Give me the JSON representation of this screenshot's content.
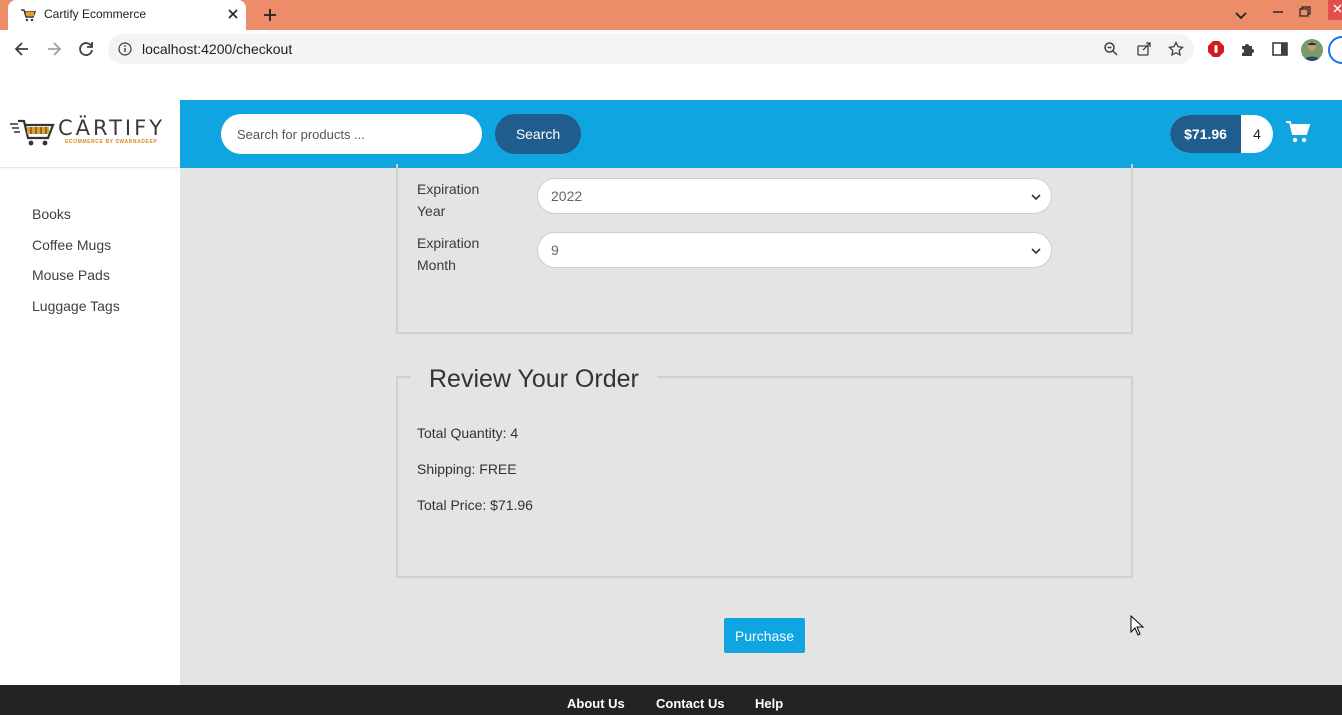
{
  "browser": {
    "tab_title": "Cartify Ecommerce",
    "url": "localhost:4200/checkout"
  },
  "logo": {
    "name": "CÄRTIFY",
    "tagline": "ECOMMERCE BY SWARNADEEP"
  },
  "sidebar": {
    "items": [
      {
        "label": "Books"
      },
      {
        "label": "Coffee Mugs"
      },
      {
        "label": "Mouse Pads"
      },
      {
        "label": "Luggage Tags"
      }
    ]
  },
  "header": {
    "search_placeholder": "Search for products ...",
    "search_button": "Search",
    "cart_total": "$71.96",
    "cart_quantity": "4"
  },
  "credit_card": {
    "expiration_year_label": "Expiration Year",
    "expiration_year_value": "2022",
    "expiration_month_label": "Expiration Month",
    "expiration_month_value": "9"
  },
  "review": {
    "legend": "Review Your Order",
    "total_quantity": "Total Quantity: 4",
    "shipping": "Shipping: FREE",
    "total_price": "Total Price: $71.96"
  },
  "purchase_button": "Purchase",
  "footer": {
    "links": [
      {
        "label": "About Us"
      },
      {
        "label": "Contact Us"
      },
      {
        "label": "Help"
      }
    ]
  },
  "colors": {
    "tab_strip": "#ec8c69",
    "header": "#0fa5e0",
    "accent_dark": "#205c8c",
    "content_bg": "#e4e4e4",
    "footer": "#232323"
  },
  "icons": [
    "cart-favicon-icon",
    "close-icon",
    "plus-icon",
    "chevron-down-icon",
    "minimize-icon",
    "restore-icon",
    "back-icon",
    "forward-icon",
    "reload-icon",
    "info-icon",
    "zoom-icon",
    "share-icon",
    "star-icon",
    "adblock-icon",
    "puzzle-icon",
    "side-panel-icon",
    "shopping-cart-icon",
    "mouse-cursor-icon"
  ]
}
